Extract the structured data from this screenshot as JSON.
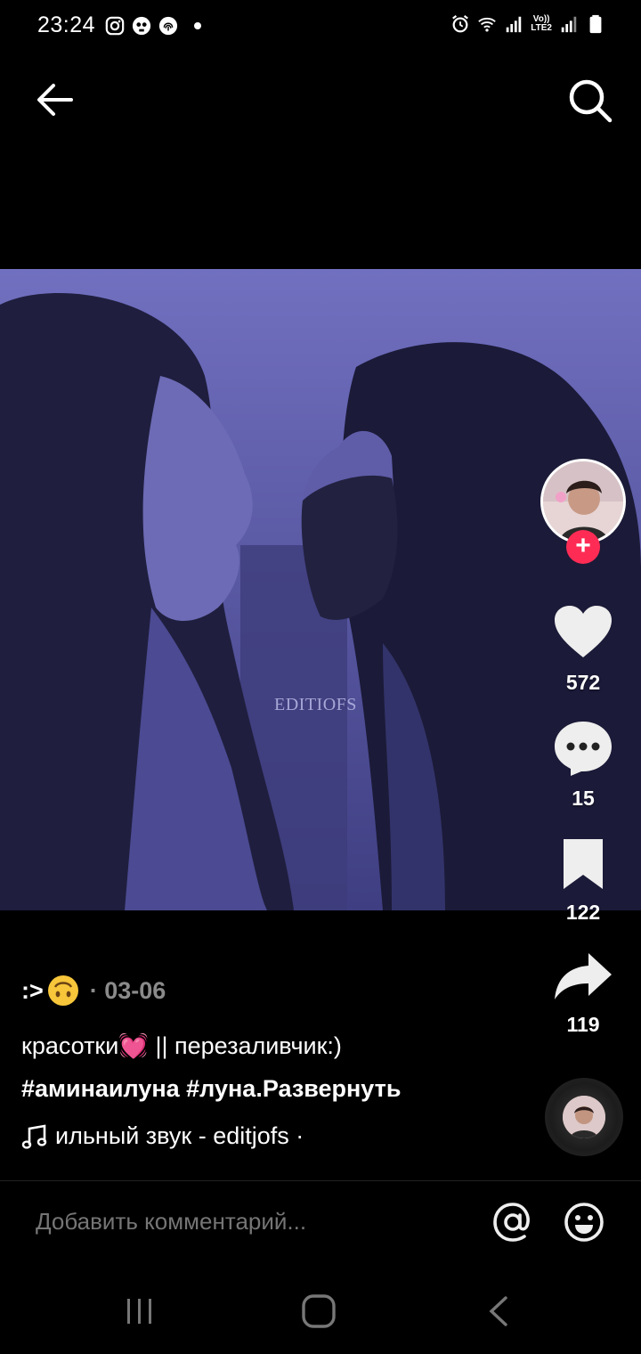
{
  "status_bar": {
    "time": "23:24",
    "left_icons": [
      "instagram-icon",
      "skull-icon",
      "fingerprint-icon",
      "notification-dot"
    ],
    "right_icons": [
      "alarm-icon",
      "wifi-icon",
      "signal-icon",
      "volte-icon",
      "signal-icon-2",
      "battery-icon"
    ],
    "volte_label_top": "Vo))",
    "volte_label_bottom": "LTE2"
  },
  "top_nav": {
    "back_icon": "arrow-left-icon",
    "search_icon": "search-icon"
  },
  "video": {
    "watermark": "EDITIOFS",
    "tint_color": "#5756a3"
  },
  "actions": {
    "follow_symbol": "+",
    "likes": "572",
    "comments": "15",
    "saves": "122",
    "shares": "119"
  },
  "post": {
    "author": ":>",
    "author_emoji": "upside-down-face-emoji",
    "date": "· 03-06",
    "caption_text": "красотки",
    "caption_emoji": "💓",
    "caption_rest": " || перезаливчик:)",
    "hashtags": "#аминаилуна #луна.",
    "expand_label": "Развернуть",
    "music": "ильный звук - editjofs ·"
  },
  "comment_bar": {
    "placeholder": "Добавить комментарий...",
    "mention_icon": "at-sign-icon",
    "emoji_icon": "smiley-icon"
  },
  "colors": {
    "accent": "#fe2c55",
    "background": "#000000",
    "muted_text": "#8a8a8a"
  }
}
